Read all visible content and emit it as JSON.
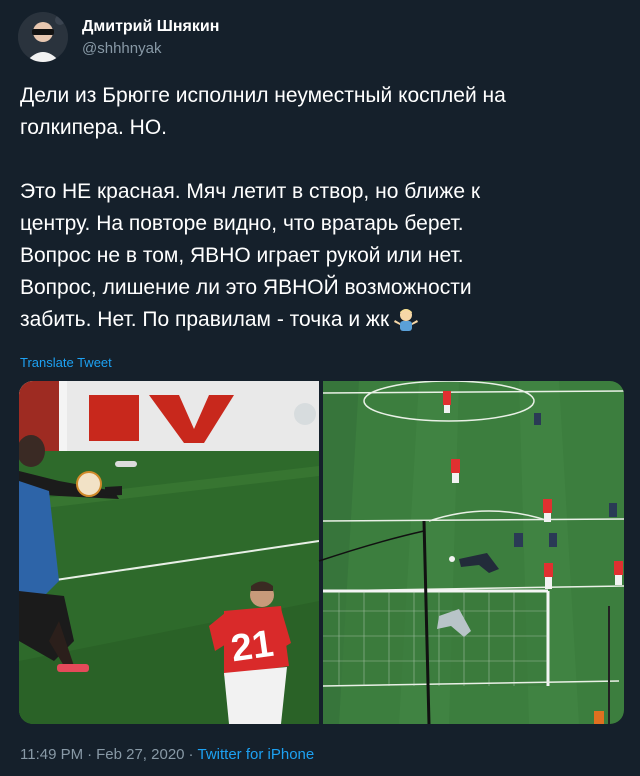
{
  "author": {
    "name": "Дмитрий Шнякин",
    "handle": "@shhhnyak"
  },
  "tweet": {
    "lines_para1": [
      "Дели из Брюгге исполнил неуместный косплей на",
      "голкипера. НО."
    ],
    "lines_para2": [
      "Это НЕ красная. Мяч летит в створ, но ближе к",
      "центру. На повторе видно, что вратарь берет.",
      "Вопрос не в том, ЯВНО играет рукой или нет.",
      "Вопрос, лишение ли это ЯВНОЙ возможности",
      "забить. Нет. По правилам - точка и жк"
    ],
    "emoji_icon": "man-shrugging-emoji-icon"
  },
  "translate_label": "Translate Tweet",
  "media": {
    "left_image": {
      "jersey_number": "21",
      "board_text": "V"
    }
  },
  "meta": {
    "time": "11:49 PM",
    "separator": "·",
    "date": "Feb 27, 2020",
    "source": "Twitter for iPhone"
  },
  "colors": {
    "background": "#15202b",
    "secondary_text": "#8899a6",
    "link": "#1da1f2"
  }
}
